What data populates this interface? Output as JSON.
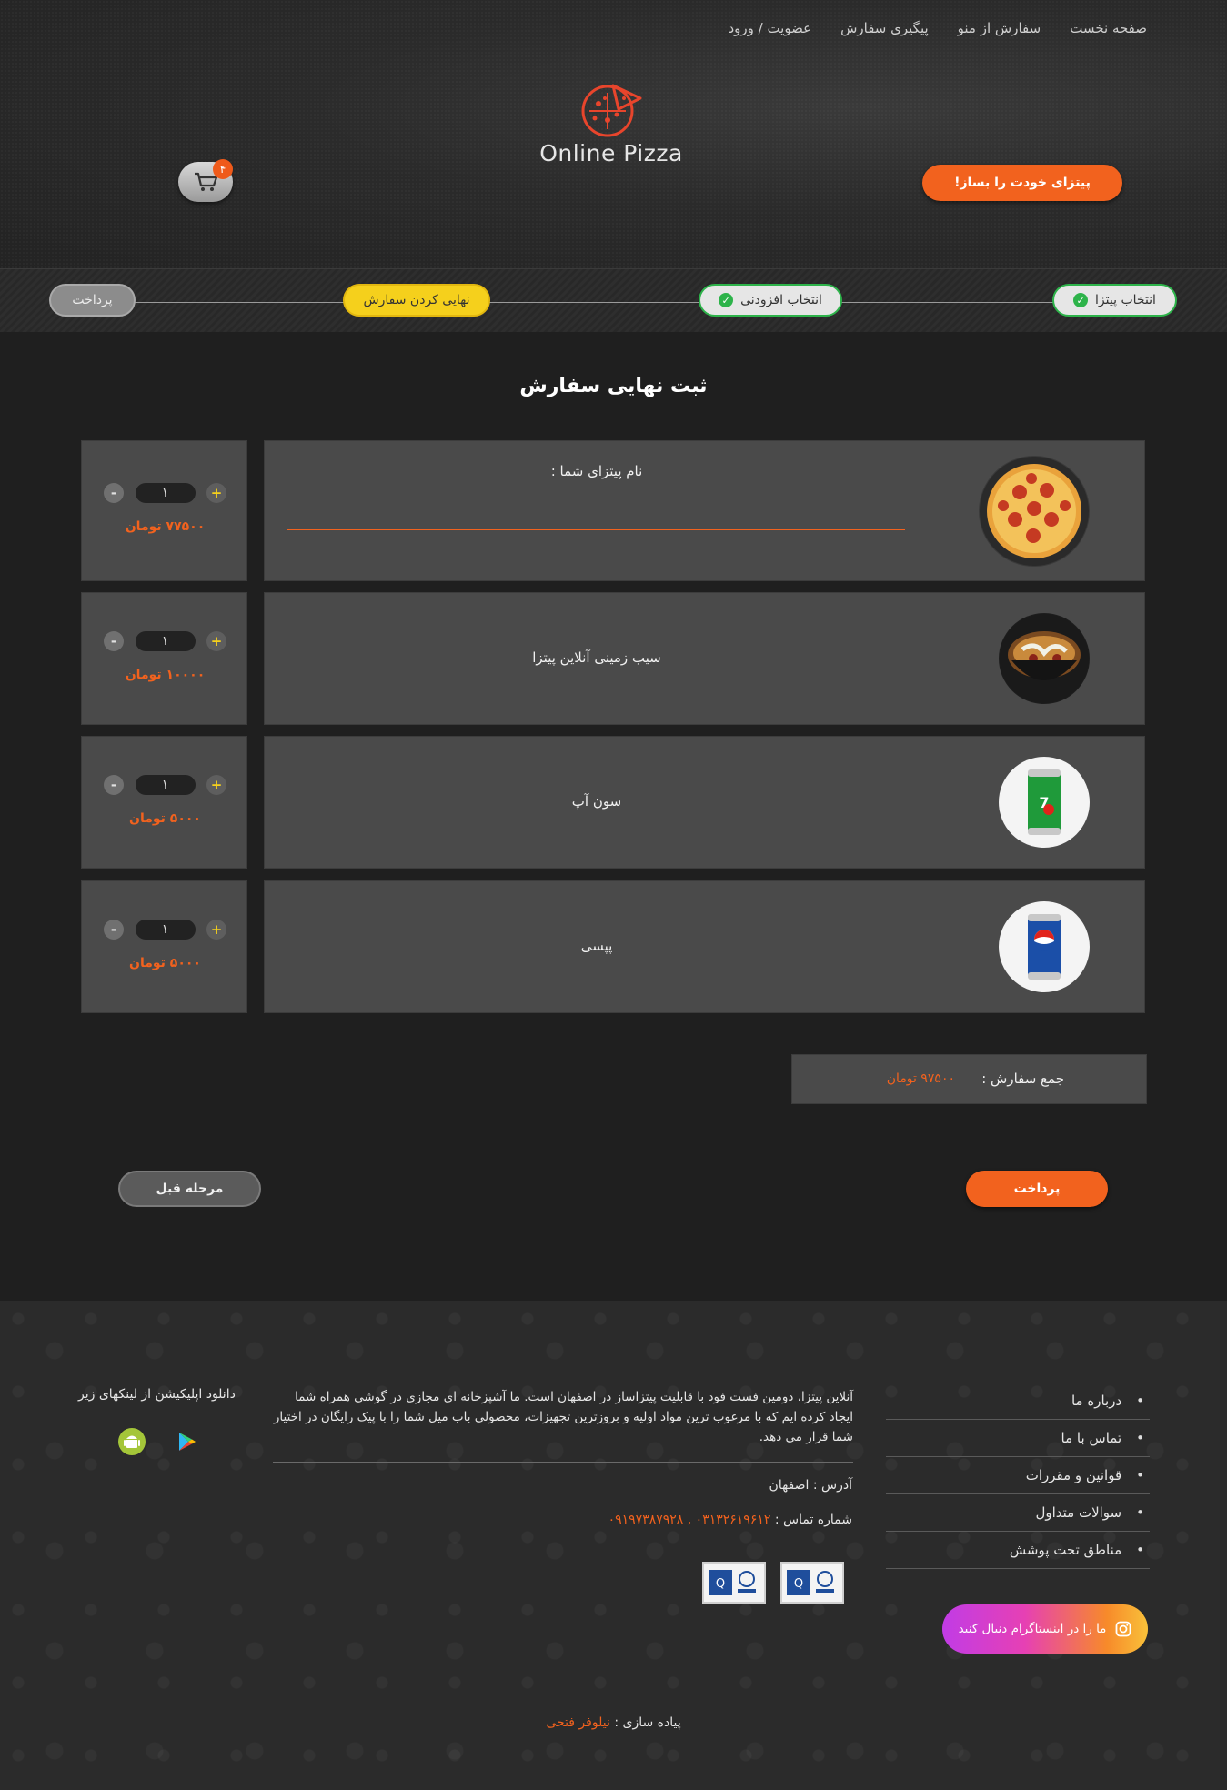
{
  "nav": {
    "home": "صفحه نخست",
    "order_menu": "سفارش از منو",
    "track": "پیگیری سفارش",
    "account": "عضویت / ورود"
  },
  "brand": {
    "logo_text": "Online Pizza"
  },
  "cart": {
    "count": "۴"
  },
  "header": {
    "build_pizza": "پیتزای خودت را بساز!"
  },
  "steps": [
    {
      "label": "انتخاب پیتزا",
      "state": "done"
    },
    {
      "label": "انتخاب افزودنی",
      "state": "done"
    },
    {
      "label": "نهایی کردن سفارش",
      "state": "active"
    },
    {
      "label": "پرداخت",
      "state": "pending"
    }
  ],
  "page_title": "ثبت نهایی سفارش",
  "items": [
    {
      "name": "نام پیتزای شما :",
      "qty": "۱",
      "price": "۷۷۵۰۰ تومان",
      "image": "pizza"
    },
    {
      "name": "سیب زمینی آنلاین پیتزا",
      "qty": "۱",
      "price": "۱۰۰۰۰ تومان",
      "image": "fries-bowl"
    },
    {
      "name": "سون آپ",
      "qty": "۱",
      "price": "۵۰۰۰ تومان",
      "image": "7up-can"
    },
    {
      "name": "پپسی",
      "qty": "۱",
      "price": "۵۰۰۰ تومان",
      "image": "pepsi-can"
    }
  ],
  "qty_controls": {
    "plus": "+",
    "minus": "-"
  },
  "total": {
    "label": "جمع سفارش :",
    "value": "۹۷۵۰۰ تومان"
  },
  "actions": {
    "pay": "پرداخت",
    "back": "مرحله قبل"
  },
  "footer": {
    "links": [
      "درباره ما",
      "تماس با ما",
      "قوانین و مقررات",
      "سوالات متداول",
      "مناطق تحت پوشش"
    ],
    "about": "آنلاین پیتزا، دومین فست فود با قابلیت پیتزاساز در اصفهان است. ما آشپزخانه ای مجازی در گوشی همراه شما ایجاد کرده ایم که با مرغوب ترین مواد اولیه و بروزترین تجهیزات، محصولی باب میل شما را با پیک رایگان در اختیار شما قرار می دهد.",
    "address": "آدرس : اصفهان",
    "phone_label": "شماره تماس :",
    "phones": "۰۳۱۳۲۶۱۹۶۱۲ , ۰۹۱۹۷۳۸۷۹۲۸",
    "instagram": "ما را در اینستاگرام دنبال کنید",
    "app_download": "دانلود اپلیکیشن از لینکهای زیر",
    "credit_label": "پیاده سازی :",
    "credit_name": "نیلوفر فتحی"
  },
  "colors": {
    "accent": "#f2621e",
    "active_step": "#f5d01c",
    "done_step": "#2db34a"
  }
}
